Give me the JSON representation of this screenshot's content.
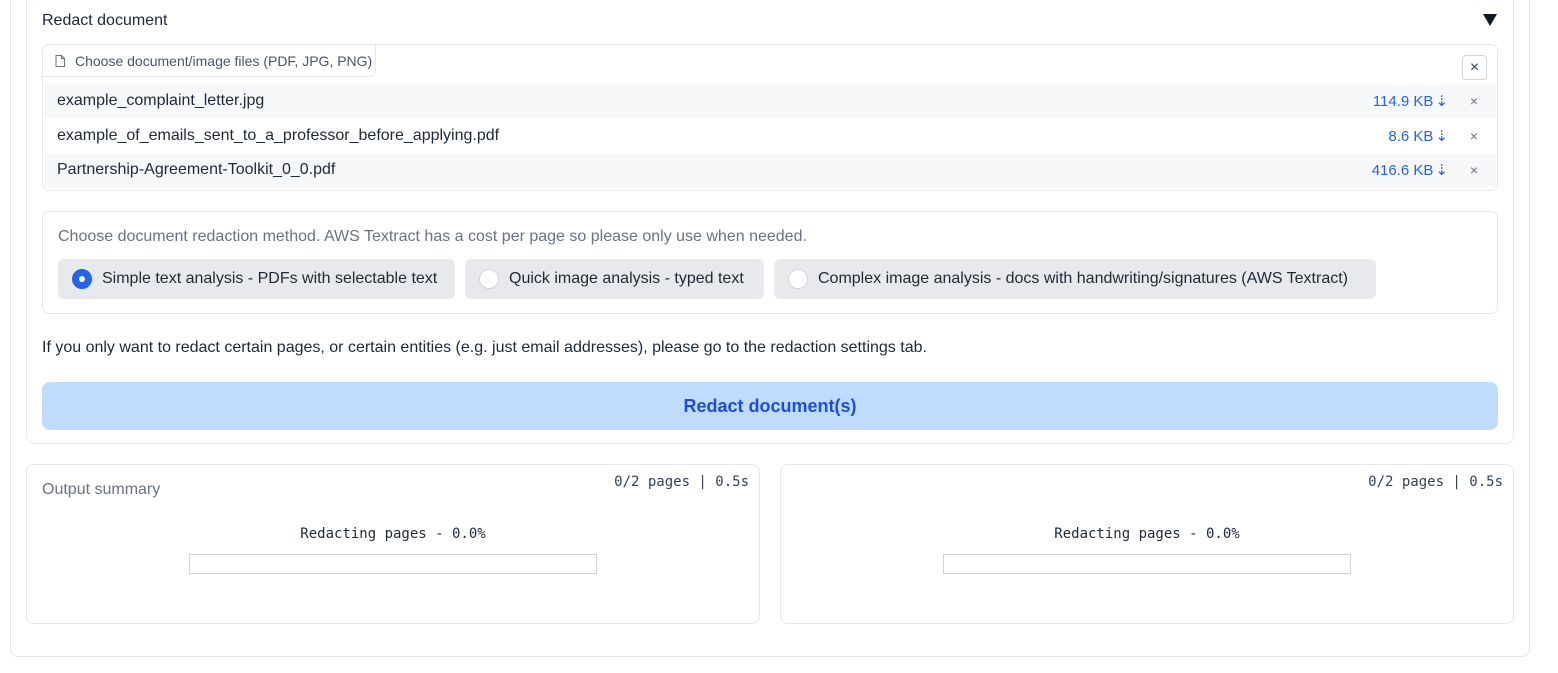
{
  "accordion": {
    "title": "Redact document",
    "toggle_icon": "triangle-down-icon"
  },
  "file_upload": {
    "label": "Choose document/image files (PDF, JPG, PNG)",
    "clear_symbol": "×",
    "files": [
      {
        "name": "example_complaint_letter.jpg",
        "size": "114.9 KB",
        "download": "⇣",
        "remove": "×"
      },
      {
        "name": "example_of_emails_sent_to_a_professor_before_applying.pdf",
        "size": "8.6 KB",
        "download": "⇣",
        "remove": "×"
      },
      {
        "name": "Partnership-Agreement-Toolkit_0_0.pdf",
        "size": "416.6 KB",
        "download": "⇣",
        "remove": "×"
      }
    ]
  },
  "redaction_method": {
    "label": "Choose document redaction method. AWS Textract has a cost per page so please only use when needed.",
    "options": [
      {
        "label": "Simple text analysis - PDFs with selectable text",
        "selected": true
      },
      {
        "label": "Quick image analysis - typed text",
        "selected": false
      },
      {
        "label": "Complex image analysis - docs with handwriting/signatures (AWS Textract)",
        "selected": false
      }
    ]
  },
  "info_text": "If you only want to redact certain pages, or certain entities (e.g. just email addresses), please go to the redaction settings tab.",
  "redact_button": "Redact document(s)",
  "output_panels": [
    {
      "label": "Output summary",
      "timer": "0/2 pages | 0.5s",
      "progress_text": "Redacting pages - 0.0%",
      "progress": 0.0
    },
    {
      "label": "",
      "timer": "0/2 pages | 0.5s",
      "progress_text": "Redacting pages - 0.0%",
      "progress": 0.0
    }
  ],
  "colors": {
    "accent": "#2563eb",
    "button_bg": "#bfdbfe",
    "button_text": "#1d4ed8"
  }
}
